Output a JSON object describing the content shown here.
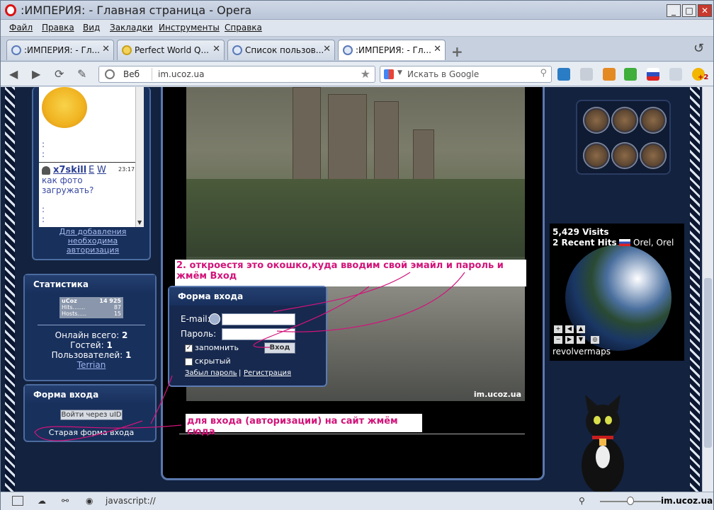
{
  "window": {
    "title": ":ИМПЕРИЯ: - Главная страница - Opera"
  },
  "menu": [
    "Файл",
    "Правка",
    "Вид",
    "Закладки",
    "Инструменты",
    "Справка"
  ],
  "tabs": [
    {
      "label": ":ИМПЕРИЯ: - Гл..."
    },
    {
      "label": "Perfect World Q..."
    },
    {
      "label": "Список пользов..."
    },
    {
      "label": ":ИМПЕРИЯ: - Гл..."
    }
  ],
  "nav": {
    "web_label": "Веб",
    "url": "im.ucoz.ua",
    "search_placeholder": "Искать в Google",
    "badge": "+2"
  },
  "chat": {
    "dots1": ":\n:",
    "user": "x7skill",
    "e": "E",
    "w": "W",
    "time": "23:17",
    "message": "как фото загружать?",
    "dots2": ":\n:",
    "auth_note": "Для добавления необходима авторизация"
  },
  "stats": {
    "title": "Статистика",
    "counter": {
      "name": "uCoz",
      "total": "14 925",
      "hits_label": "Hits.......",
      "hits": "87",
      "hosts_label": "Hosts.....",
      "hosts": "15"
    },
    "online": "Онлайн всего: ",
    "online_val": "2",
    "guests": "Гостей: ",
    "guests_val": "1",
    "users": "Пользователей: ",
    "users_val": "1",
    "member": "Terrian"
  },
  "login_left": {
    "title": "Форма входа",
    "uid_button": "Войти через uID",
    "old_form": "Старая форма входа"
  },
  "login_popup": {
    "title": "Форма входа",
    "email_label": "E-mail:",
    "password_label": "Пароль:",
    "remember": "запомнить",
    "hidden": "скрытый",
    "submit": "Вход",
    "forgot": "Забыл пароль",
    "sep": "|",
    "register": "Регистрация"
  },
  "annotations": {
    "top": "2. откроестя это окошко,куда вводим свой эмайл и пароль и жмём Вход",
    "bottom": "для входа (авторизации) на сайт жмём сюда"
  },
  "watermark": "im.ucoz.ua",
  "revolver": {
    "visits": "5,429 Visits",
    "hits": "2 Recent Hits",
    "location": "Orel, Orel",
    "brand": "revolvermaps"
  },
  "status": {
    "text": "javascript://",
    "corner": "im.ucoz.ua"
  }
}
